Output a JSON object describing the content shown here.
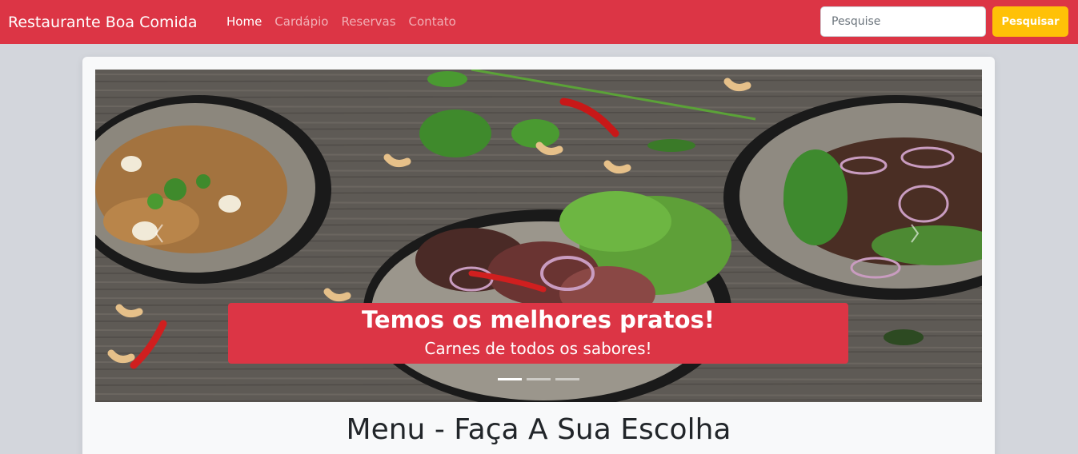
{
  "navbar": {
    "brand": "Restaurante Boa Comida",
    "links": [
      {
        "label": "Home",
        "active": true
      },
      {
        "label": "Cardápio",
        "active": false
      },
      {
        "label": "Reservas",
        "active": false
      },
      {
        "label": "Contato",
        "active": false
      }
    ],
    "search_placeholder": "Pesquise",
    "search_button": "Pesquisar"
  },
  "carousel": {
    "caption_title": "Temos os melhores pratos!",
    "caption_text": "Carnes de todos os sabores!",
    "slide_count": 3,
    "active_slide": 1
  },
  "main": {
    "heading": "Menu - Faça A Sua Escolha"
  },
  "colors": {
    "navbar_bg": "#dc3545",
    "search_button_bg": "#ffc107",
    "page_bg": "#d3d6dc",
    "card_bg": "#f8f9fa"
  }
}
